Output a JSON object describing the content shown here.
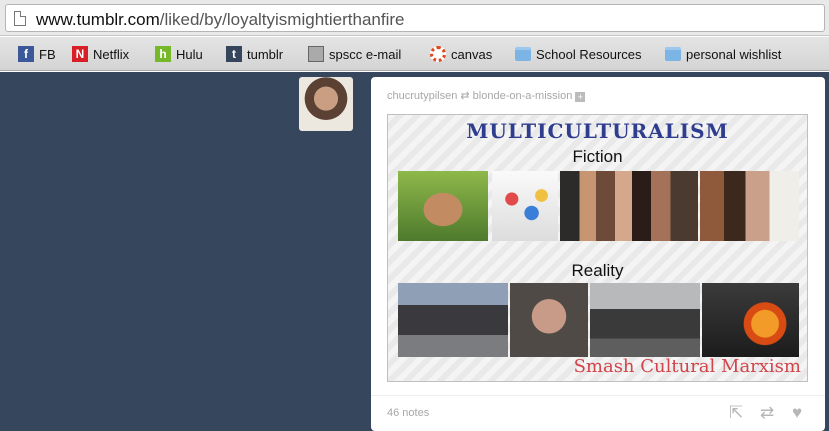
{
  "browser": {
    "url_host": "www.tumblr.com",
    "url_path": "/liked/by/loyaltyismightierthanfire"
  },
  "bookmarks": [
    {
      "label": "FB",
      "icon": "facebook-icon",
      "glyph": "f"
    },
    {
      "label": "Netflix",
      "icon": "netflix-icon",
      "glyph": "N"
    },
    {
      "label": "Hulu",
      "icon": "hulu-icon",
      "glyph": "h"
    },
    {
      "label": "tumblr",
      "icon": "tumblr-icon",
      "glyph": "t"
    },
    {
      "label": "spscc e-mail",
      "icon": "spscc-icon",
      "glyph": ""
    },
    {
      "label": "canvas",
      "icon": "canvas-icon",
      "glyph": ""
    },
    {
      "label": "School Resources",
      "icon": "folder-icon",
      "glyph": ""
    },
    {
      "label": "personal wishlist",
      "icon": "folder-icon",
      "glyph": ""
    }
  ],
  "post": {
    "author": "chucrutypilsen",
    "reblogged_from": "blonde-on-a-mission",
    "notes": "46 notes"
  },
  "meme": {
    "title": "MULTICULTURALISM",
    "top_label": "Fiction",
    "bottom_label": "Reality",
    "slogan": "Smash Cultural Marxism"
  },
  "colors": {
    "dashboard_bg": "#36465d",
    "meme_title": "#2f3d8f",
    "meme_slogan": "#d2444a"
  }
}
